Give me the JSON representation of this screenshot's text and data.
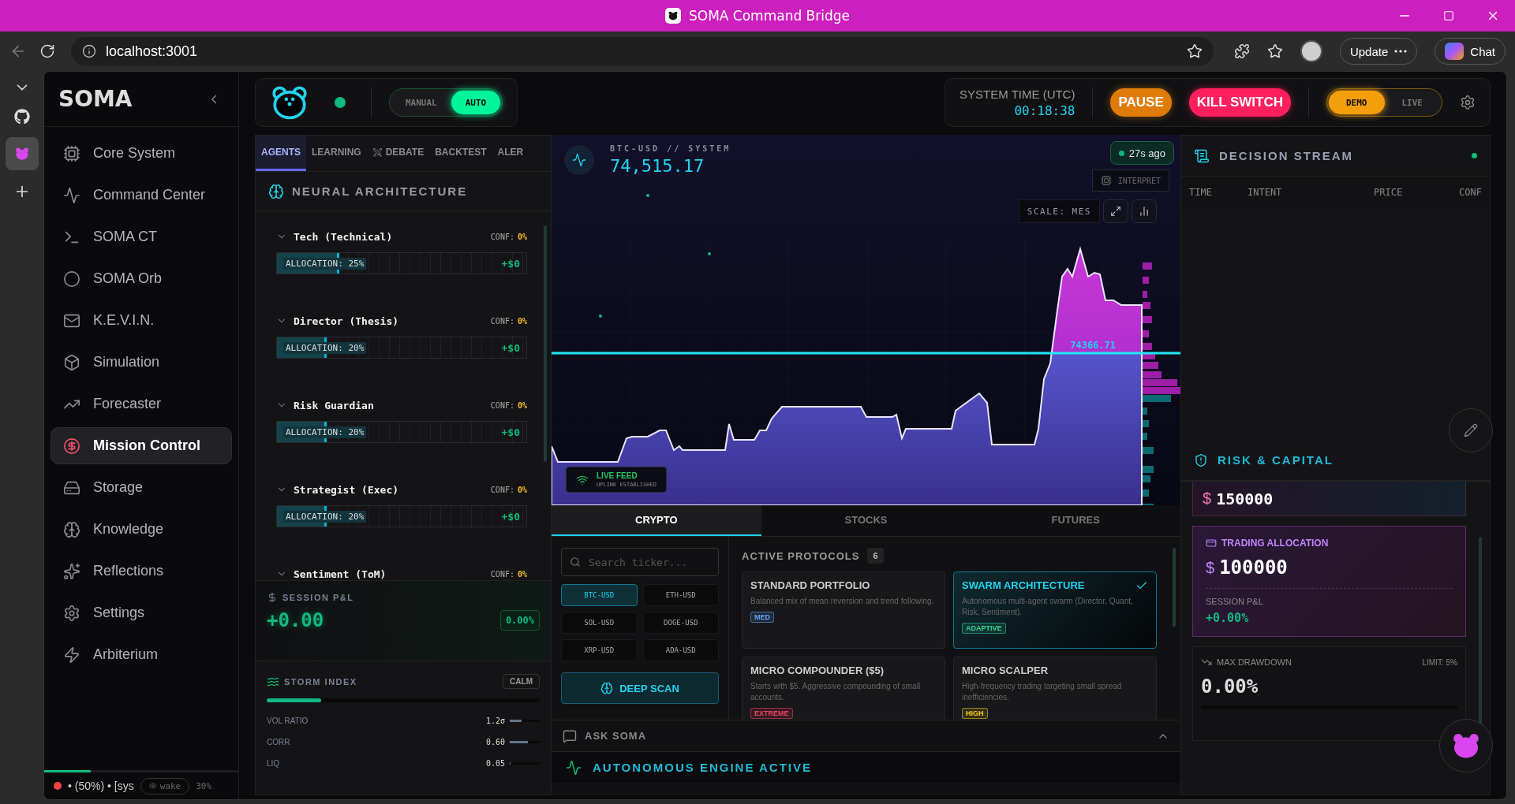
{
  "browser": {
    "title": "SOMA Command Bridge",
    "url": "localhost:3001",
    "update": "Update",
    "chat": "Chat"
  },
  "sidebar": {
    "logo": "SOMA",
    "items": [
      {
        "label": "Core System",
        "selected": false
      },
      {
        "label": "Command Center",
        "selected": false
      },
      {
        "label": "SOMA CT",
        "selected": false
      },
      {
        "label": "SOMA Orb",
        "selected": false
      },
      {
        "label": "K.E.V.I.N.",
        "selected": false
      },
      {
        "label": "Simulation",
        "selected": false
      },
      {
        "label": "Forecaster",
        "selected": false
      },
      {
        "label": "Mission Control",
        "selected": true
      },
      {
        "label": "Storage",
        "selected": false
      },
      {
        "label": "Knowledge",
        "selected": false
      },
      {
        "label": "Reflections",
        "selected": false
      },
      {
        "label": "Settings",
        "selected": false
      },
      {
        "label": "Arbiterium",
        "selected": false
      }
    ],
    "status": {
      "level": 0.24,
      "text": "• (50%) • [sys",
      "wake": "wake",
      "percent": "30%"
    }
  },
  "header": {
    "modes": [
      {
        "label": "MANUAL",
        "selected": false
      },
      {
        "label": "AUTO",
        "selected": true
      }
    ],
    "time_label": "SYSTEM TIME (UTC)",
    "time": "00:18:38",
    "pause": "PAUSE",
    "kill": "KILL SWITCH",
    "env": [
      {
        "label": "DEMO",
        "selected": true
      },
      {
        "label": "LIVE",
        "selected": false
      }
    ]
  },
  "left_panel": {
    "tabs": [
      {
        "label": "AGENTS",
        "selected": true
      },
      {
        "label": "LEARNING",
        "selected": false
      },
      {
        "label": "DEBATE",
        "selected": false
      },
      {
        "label": "BACKTEST",
        "selected": false
      },
      {
        "label": "ALER",
        "selected": false
      }
    ],
    "title": "NEURAL ARCHITECTURE",
    "agents": [
      {
        "name": "Tech (Technical)",
        "conf_label": "CONF:",
        "conf": "0%",
        "allocation": "ALLOCATION: 25%",
        "level": 0.25,
        "pnl": "+$0"
      },
      {
        "name": "Director (Thesis)",
        "conf_label": "CONF:",
        "conf": "0%",
        "allocation": "ALLOCATION: 20%",
        "level": 0.2,
        "pnl": "+$0"
      },
      {
        "name": "Risk Guardian",
        "conf_label": "CONF:",
        "conf": "0%",
        "allocation": "ALLOCATION: 20%",
        "level": 0.2,
        "pnl": "+$0"
      },
      {
        "name": "Strategist (Exec)",
        "conf_label": "CONF:",
        "conf": "0%",
        "allocation": "ALLOCATION: 20%",
        "level": 0.2,
        "pnl": "+$0"
      },
      {
        "name": "Sentiment (ToM)",
        "conf_label": "CONF:",
        "conf": "0%"
      }
    ],
    "session": {
      "label": "SESSION P&L",
      "value": "+0.00",
      "percent": "0.00%"
    },
    "storm": {
      "title": "STORM INDEX",
      "badge": "CALM",
      "level": 0.2,
      "metrics": [
        {
          "label": "VOL RATIO",
          "value": "1.2σ",
          "level": 0.4
        },
        {
          "label": "CORR",
          "value": "0.60",
          "level": 0.6
        },
        {
          "label": "LIQ",
          "value": "0.05",
          "level": 0.02
        }
      ]
    }
  },
  "chart": {
    "symbol": "BTC-USD // SYSTEM",
    "price": "74,515.17",
    "updated": "27s ago",
    "interpret": "INTERPRET",
    "scale": "SCALE: MES",
    "line_price": "74366.71",
    "feed_title": "LIVE FEED",
    "feed_subtitle": "UPLINK ESTABLISHED"
  },
  "markets": {
    "tabs": [
      {
        "label": "CRYPTO",
        "selected": true
      },
      {
        "label": "STOCKS",
        "selected": false
      },
      {
        "label": "FUTURES",
        "selected": false
      }
    ],
    "search_placeholder": "Search ticker...",
    "tickers": [
      {
        "label": "BTC-USD",
        "selected": true
      },
      {
        "label": "ETH-USD",
        "selected": false
      },
      {
        "label": "SOL-USD",
        "selected": false
      },
      {
        "label": "DOGE-USD",
        "selected": false
      },
      {
        "label": "XRP-USD",
        "selected": false
      },
      {
        "label": "ADA-USD",
        "selected": false
      }
    ],
    "scan": "DEEP SCAN"
  },
  "protocols": {
    "title": "ACTIVE PROTOCOLS",
    "count": "6",
    "items": [
      {
        "name": "STANDARD PORTFOLIO",
        "description": "Balanced mix of mean reversion and trend following.",
        "tag": "MED",
        "color": "#60a5fa",
        "selected": false
      },
      {
        "name": "SWARM ARCHITECTURE",
        "description": "Autonomous multi-agent swarm (Director, Quant, Risk, Sentiment).",
        "tag": "ADAPTIVE",
        "color": "#34d399",
        "selected": true
      },
      {
        "name": "MICRO COMPOUNDER ($5)",
        "description": "Starts with $5. Aggressive compounding of small accounts.",
        "tag": "EXTREME",
        "color": "#f43f5e",
        "selected": false
      },
      {
        "name": "MICRO SCALPER",
        "description": "High-frequency trading targeting small spread inefficiencies.",
        "tag": "HIGH",
        "color": "#facc15",
        "selected": false
      }
    ]
  },
  "ask": {
    "label": "ASK SOMA"
  },
  "engine": {
    "label": "AUTONOMOUS ENGINE ACTIVE"
  },
  "decision_stream": {
    "title": "DECISION STREAM",
    "columns": [
      "TIME",
      "INTENT",
      "PRICE",
      "CONF"
    ]
  },
  "risk": {
    "title": "RISK & CAPITAL",
    "capital": {
      "currency": "$",
      "value": "150000"
    },
    "allocation": {
      "label": "TRADING ALLOCATION",
      "currency": "$",
      "value": "100000",
      "pnl_label": "SESSION P&L",
      "pnl": "+0.00%"
    },
    "drawdown": {
      "label": "MAX DRAWDOWN",
      "limit": "LIMIT: 5%",
      "value": "0.00%",
      "level": 0
    }
  }
}
